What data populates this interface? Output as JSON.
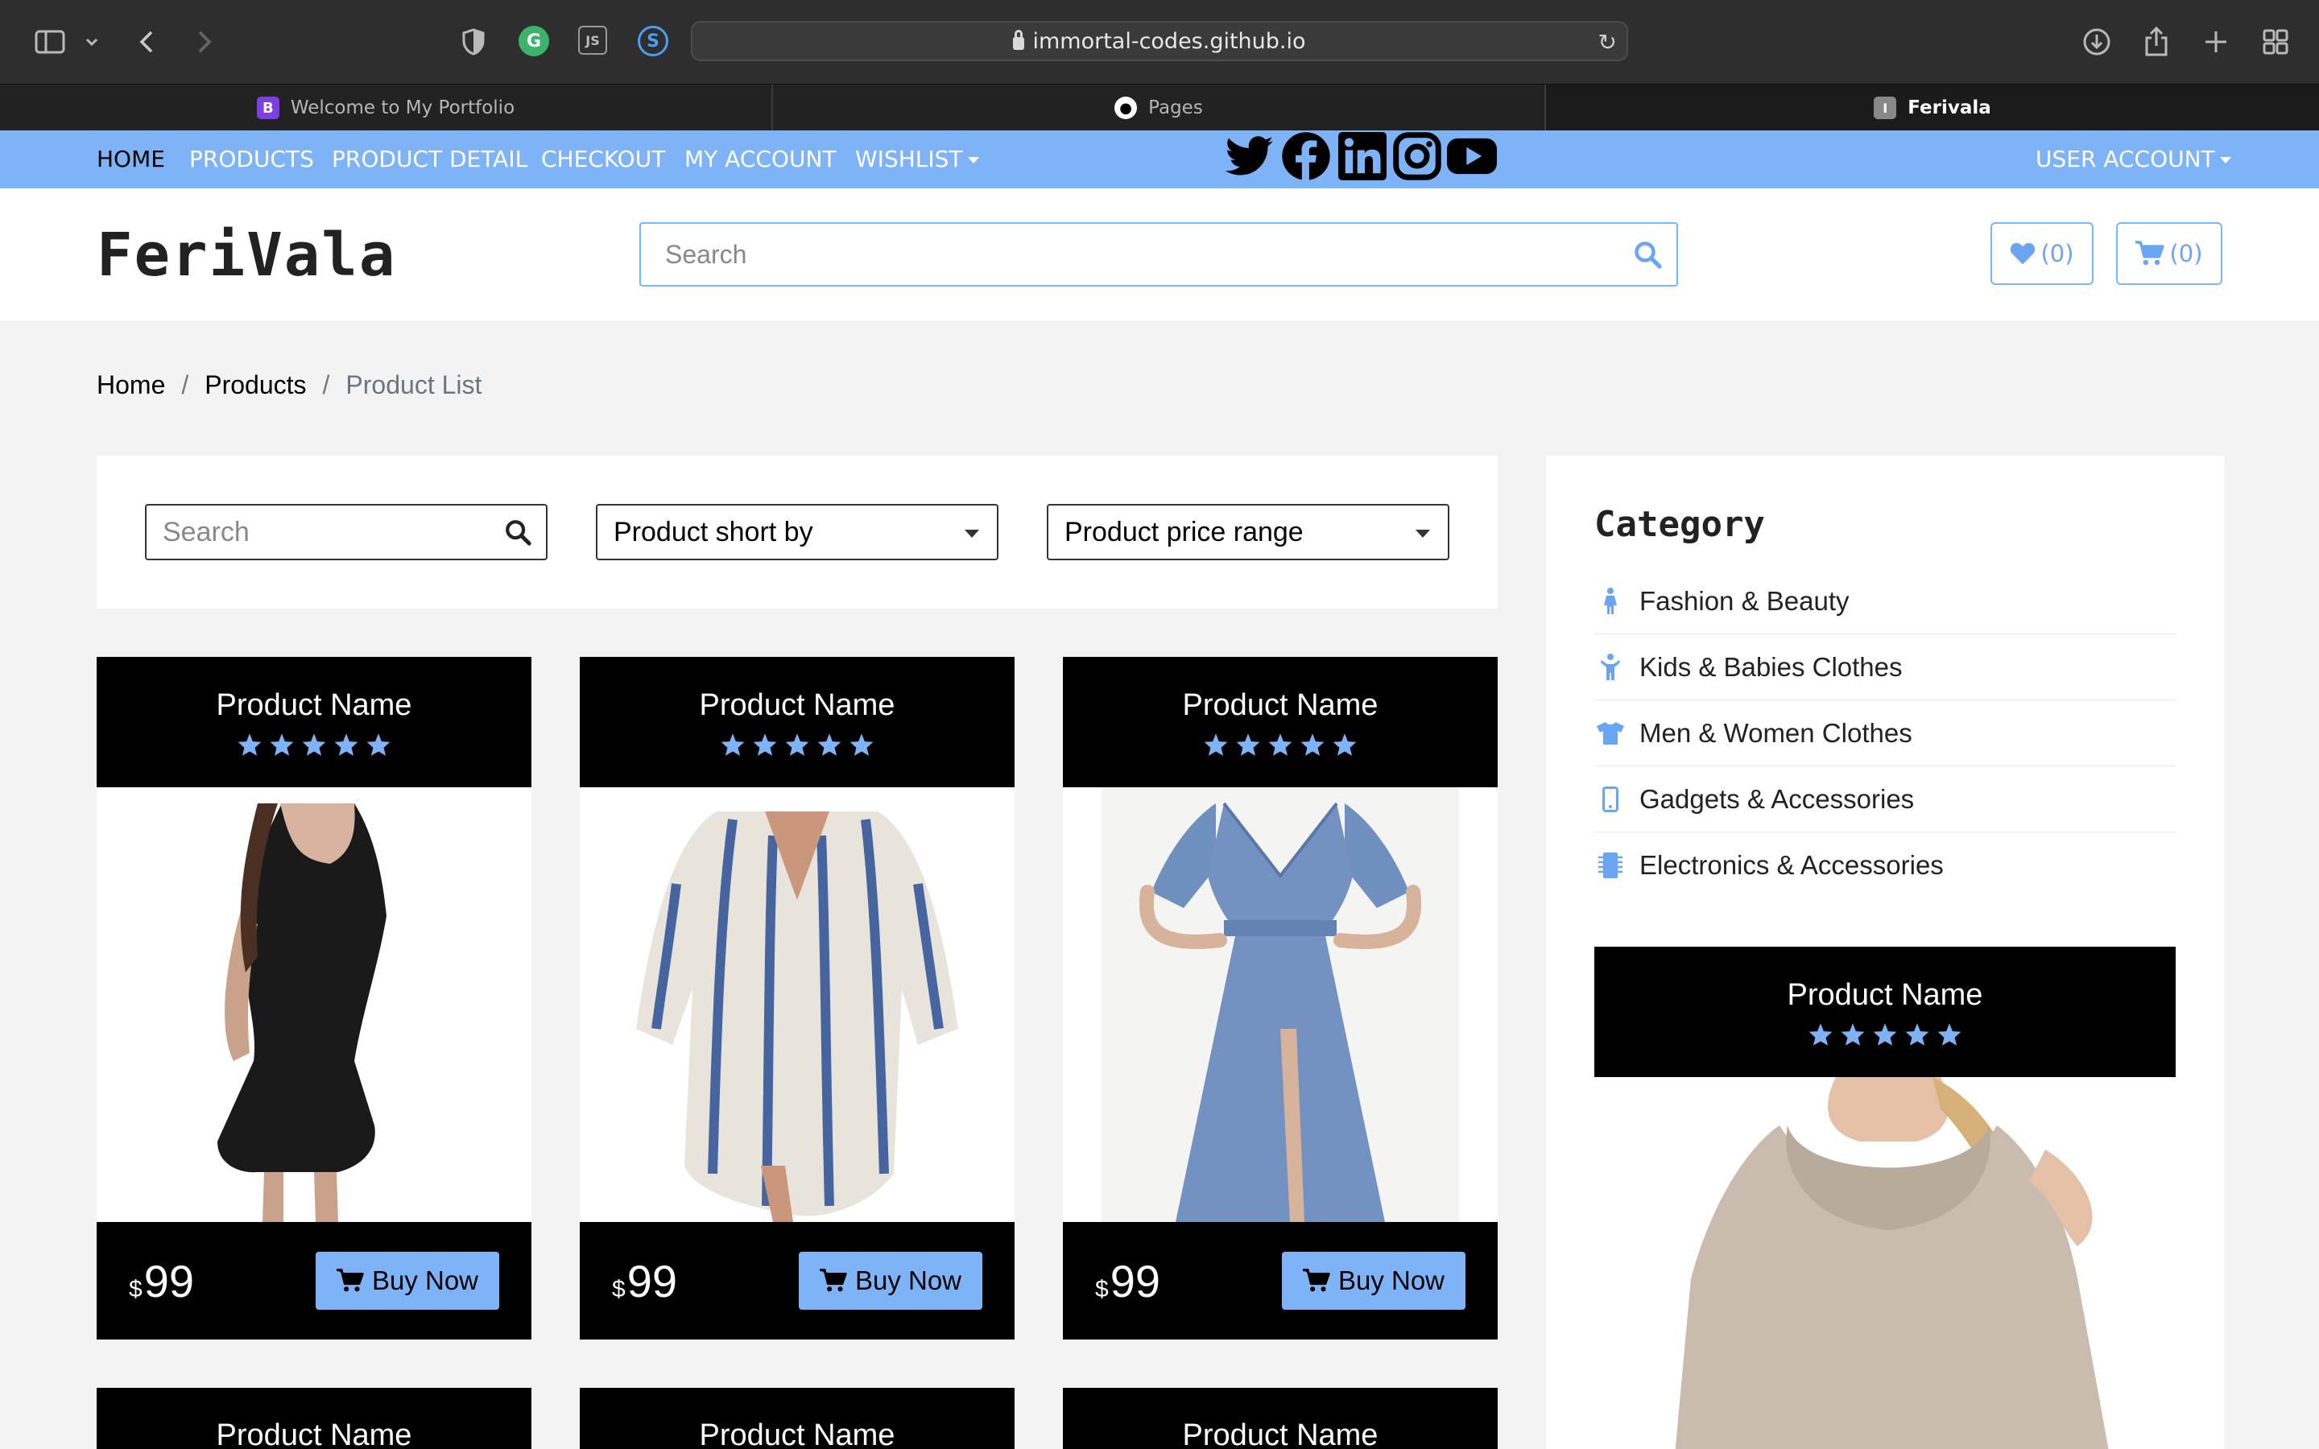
{
  "browser": {
    "url": "immortal-codes.github.io",
    "tabs": [
      {
        "label": "Welcome to My Portfolio",
        "favicon": "B"
      },
      {
        "label": "Pages",
        "favicon": "github-icon"
      },
      {
        "label": "Ferivala",
        "favicon": "I"
      }
    ],
    "extensions": [
      "shield-icon",
      "grammarly-icon",
      "js-icon",
      "s-icon"
    ]
  },
  "nav": {
    "links": [
      "HOME",
      "PRODUCTS",
      "PRODUCT DETAIL",
      "CHECKOUT",
      "MY ACCOUNT",
      "WISHLIST"
    ],
    "user_account": "USER ACCOUNT",
    "social": [
      "twitter-icon",
      "facebook-icon",
      "linkedin-icon",
      "instagram-icon",
      "youtube-icon"
    ]
  },
  "header": {
    "logo": "FeriVala",
    "search_placeholder": "Search",
    "wishlist_count": "(0)",
    "cart_count": "(0)"
  },
  "breadcrumb": {
    "home": "Home",
    "products": "Products",
    "current": "Product List"
  },
  "filters": {
    "search_placeholder": "Search",
    "sort_label": "Product short by",
    "price_label": "Product price range"
  },
  "products": [
    {
      "name": "Product Name",
      "rating": 5,
      "currency": "$",
      "price": "99",
      "button": "Buy Now",
      "image": "black-dress"
    },
    {
      "name": "Product Name",
      "rating": 5,
      "currency": "$",
      "price": "99",
      "button": "Buy Now",
      "image": "tie-dye-dress"
    },
    {
      "name": "Product Name",
      "rating": 5,
      "currency": "$",
      "price": "99",
      "button": "Buy Now",
      "image": "blue-gown"
    },
    {
      "name": "Product Name"
    },
    {
      "name": "Product Name"
    },
    {
      "name": "Product Name"
    }
  ],
  "sidebar": {
    "title": "Category",
    "categories": [
      {
        "label": "Fashion & Beauty",
        "icon": "female-icon"
      },
      {
        "label": "Kids & Babies Clothes",
        "icon": "child-icon"
      },
      {
        "label": "Men & Women Clothes",
        "icon": "tshirt-icon"
      },
      {
        "label": "Gadgets & Accessories",
        "icon": "mobile-icon"
      },
      {
        "label": "Electronics & Accessories",
        "icon": "microchip-icon"
      }
    ],
    "featured": {
      "name": "Product Name",
      "rating": 5,
      "image": "beige-sweater"
    }
  },
  "colors": {
    "accent": "#7fb3f7",
    "star": "#7fb3f7",
    "card_bg": "#000000"
  }
}
